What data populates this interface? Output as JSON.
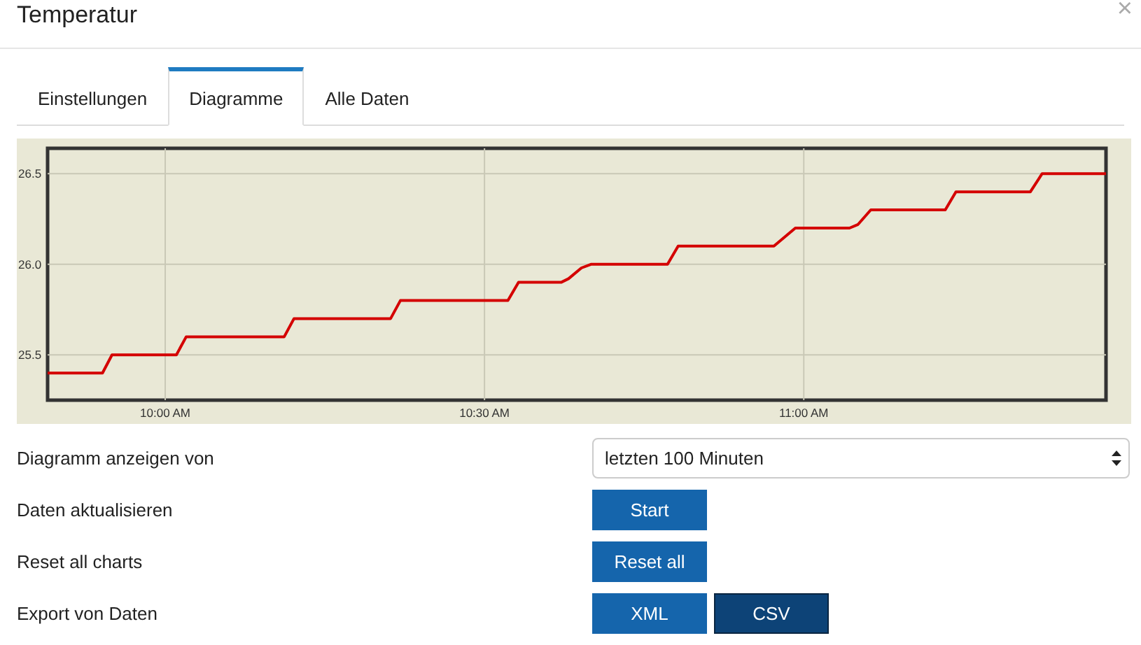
{
  "window": {
    "title": "Temperatur",
    "close": "×"
  },
  "tabs": [
    {
      "label": "Einstellungen",
      "selected": false
    },
    {
      "label": "Diagramme",
      "selected": true
    },
    {
      "label": "Alle Daten",
      "selected": false
    }
  ],
  "chart": {
    "chart_data": {
      "type": "line",
      "x": [
        9.8158,
        9.9017,
        9.9167,
        10.0175,
        10.0328,
        10.1863,
        10.2017,
        10.353,
        10.3683,
        10.5367,
        10.5533,
        10.62,
        10.6317,
        10.6517,
        10.6667,
        10.7867,
        10.8033,
        10.9533,
        10.9867,
        11.0717,
        11.085,
        11.105,
        11.2217,
        11.2383,
        11.355,
        11.3733,
        11.4733
      ],
      "series": [
        {
          "color": "#d40000",
          "values": [
            25.4,
            25.4,
            25.5,
            25.5,
            25.6,
            25.6,
            25.7,
            25.7,
            25.8,
            25.8,
            25.9,
            25.9,
            25.92,
            25.98,
            26.0,
            26.0,
            26.1,
            26.1,
            26.2,
            26.2,
            26.22,
            26.3,
            26.3,
            26.4,
            26.4,
            26.5,
            26.5
          ]
        }
      ],
      "grid": true,
      "xlim": [
        9.8158,
        11.4733
      ],
      "ylim": [
        25.25,
        26.64
      ],
      "xticks": [
        {
          "value": 10,
          "label": "10:00 AM"
        },
        {
          "value": 10.5,
          "label": "10:30 AM"
        },
        {
          "value": 11,
          "label": "11:00 AM"
        }
      ],
      "yticks": [
        {
          "value": 25.5,
          "label": "25.5"
        },
        {
          "value": 26.0,
          "label": "26.0"
        },
        {
          "value": 26.5,
          "label": "26.5"
        }
      ]
    }
  },
  "form": [
    {
      "kind": "select",
      "label": "Diagramm anzeigen von",
      "value": "letzten 100 Minuten"
    },
    {
      "kind": "buttons",
      "label": "Daten aktualisieren",
      "buttons": [
        {
          "label": "Start",
          "selected": false
        }
      ]
    },
    {
      "kind": "buttons",
      "label": "Reset all charts",
      "buttons": [
        {
          "label": "Reset all",
          "selected": false
        }
      ]
    },
    {
      "kind": "buttons",
      "label": "Export von Daten",
      "buttons": [
        {
          "label": "XML",
          "selected": false
        },
        {
          "label": "CSV",
          "selected": true
        }
      ]
    }
  ]
}
